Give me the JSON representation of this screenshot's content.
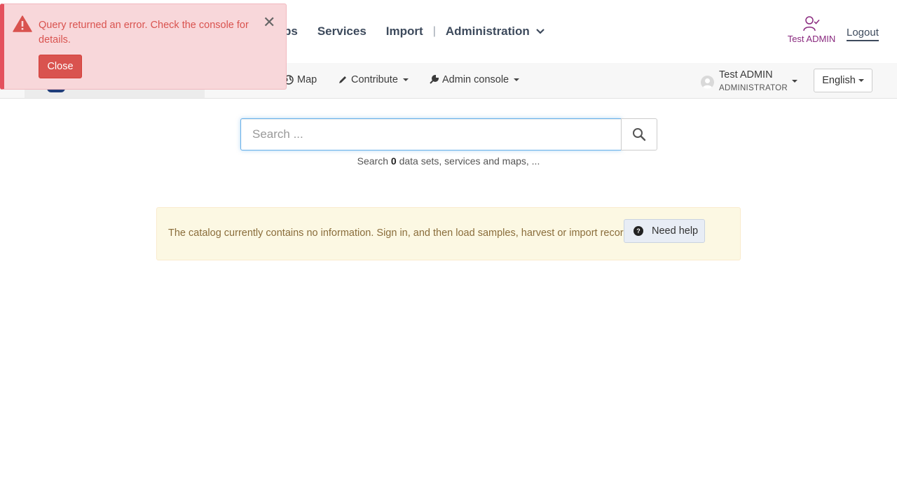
{
  "header": {
    "nav_items": [
      "ps",
      "Services",
      "Import"
    ],
    "separator": "|",
    "admin_label": "Administration",
    "user_name": "Test ADMIN",
    "logout_label": "Logout"
  },
  "navbar": {
    "map_label": "Map",
    "contribute_label": "Contribute",
    "admin_console_label": "Admin console",
    "user_name": "Test ADMIN",
    "user_role": "ADMINISTRATOR",
    "language": "English"
  },
  "search": {
    "placeholder": "Search ...",
    "hint_prefix": "Search",
    "hint_count": "0",
    "hint_suffix": "data sets, services and maps, ..."
  },
  "info_panel": {
    "message": "The catalog currently contains no information. Sign in, and then load samples, harvest or import records.",
    "help_label": "Need help"
  },
  "toast": {
    "message": "Query returned an error. Check the console for details.",
    "close_label": "Close",
    "dismiss_glyph": "✕"
  },
  "colors": {
    "accent_purple": "#8a2a7f",
    "error_red": "#d9534f",
    "info_bg": "#fcf8e3",
    "focus_blue": "#66afe9"
  }
}
